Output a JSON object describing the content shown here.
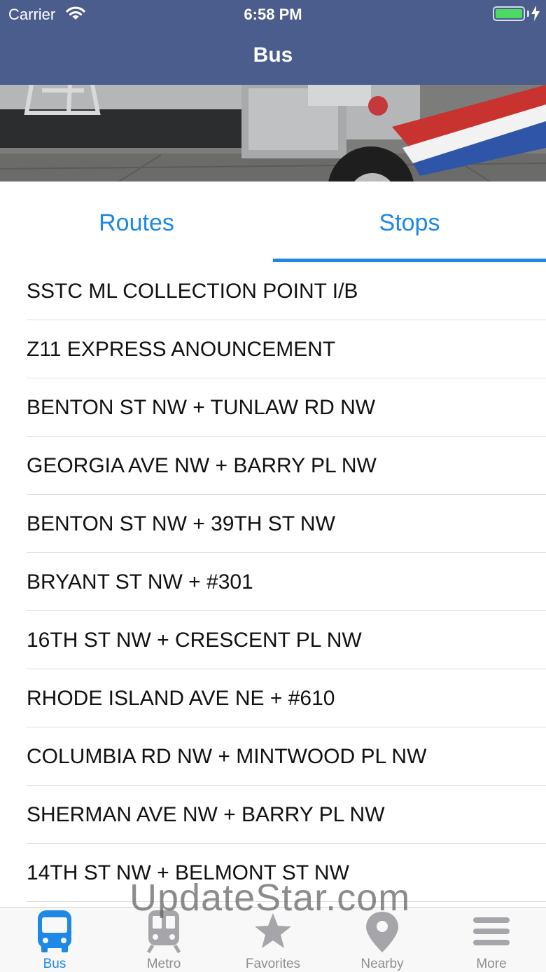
{
  "status_bar": {
    "carrier": "Carrier",
    "time": "6:58 PM",
    "battery_level": 1.0
  },
  "nav": {
    "title": "Bus"
  },
  "segments": {
    "items": [
      {
        "label": "Routes",
        "selected": false
      },
      {
        "label": "Stops",
        "selected": true
      }
    ]
  },
  "stops": [
    "SSTC ML COLLECTION POINT I/B",
    "Z11 EXPRESS ANOUNCEMENT",
    "BENTON ST NW + TUNLAW RD NW",
    "GEORGIA AVE NW + BARRY PL NW",
    "BENTON ST NW + 39TH ST NW",
    "BRYANT ST NW + #301",
    "16TH ST NW + CRESCENT PL NW",
    "RHODE ISLAND AVE NE + #610",
    "COLUMBIA RD NW + MINTWOOD PL NW",
    "SHERMAN AVE NW + BARRY PL NW",
    "14TH ST NW + BELMONT ST NW"
  ],
  "watermark": "UpdateStar.com",
  "tab_bar": {
    "items": [
      {
        "label": "Bus",
        "icon": "bus-icon",
        "active": true
      },
      {
        "label": "Metro",
        "icon": "metro-train-icon",
        "active": false
      },
      {
        "label": "Favorites",
        "icon": "star-icon",
        "active": false
      },
      {
        "label": "Nearby",
        "icon": "map-pin-icon",
        "active": false
      },
      {
        "label": "More",
        "icon": "menu-icon",
        "active": false
      }
    ]
  },
  "colors": {
    "nav_bar": "#4a5d8d",
    "accent": "#1e88e5",
    "inactive_tab": "#8e8e93",
    "battery_fill": "#4cd964"
  }
}
